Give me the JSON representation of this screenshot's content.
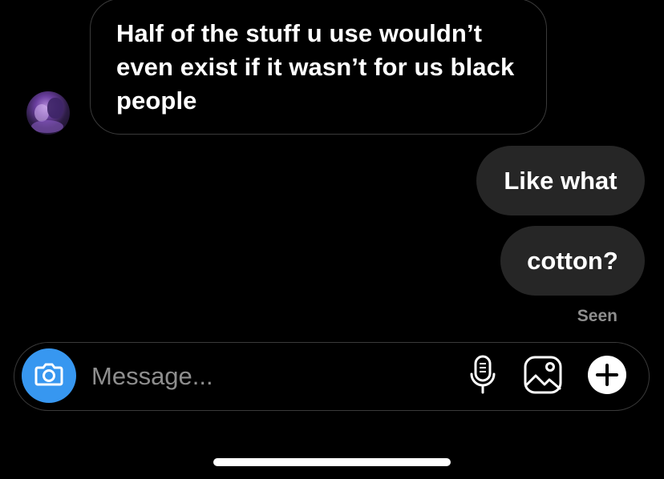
{
  "thread": {
    "received_message": "Half of the stuff u use wouldn’t even exist if it wasn’t for us black people",
    "sent_messages": [
      "Like what",
      "cotton?"
    ],
    "status": "Seen"
  },
  "composer": {
    "placeholder": "Message...",
    "value": ""
  },
  "icons": {
    "camera": "camera-icon",
    "microphone": "microphone-icon",
    "gallery": "gallery-icon",
    "plus": "plus-icon"
  },
  "colors": {
    "background": "#000000",
    "sent_bubble": "#262626",
    "camera_accent": "#3797f0",
    "muted_text": "#8e8e8e"
  }
}
